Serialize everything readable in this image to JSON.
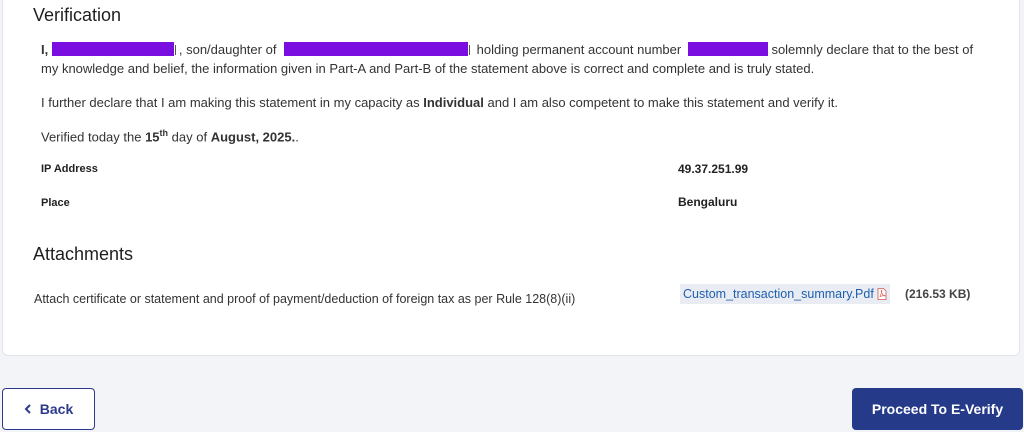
{
  "verification": {
    "title": "Verification",
    "line1": {
      "prefix": "I,",
      "after_name": ", son/daughter of",
      "after_parent": " holding permanent account number",
      "after_pan": " solemnly declare that to the best of",
      "line2": "my knowledge and belief, the information given in Part-A and Part-B of the statement above is correct and complete and is truly stated."
    },
    "capacity": {
      "prefix": "I further declare that I am making this statement in my capacity as ",
      "role": "Individual",
      "suffix": " and I am also competent to make this statement and verify it."
    },
    "verified": {
      "prefix": "Verified today the ",
      "day": "15",
      "day_suffix": "th",
      "middle": " day of ",
      "month_year": "August, 2025.",
      "end": "."
    },
    "ip_label": "IP Address",
    "ip_value": "49.37.251.99",
    "place_label": "Place",
    "place_value": "Bengaluru"
  },
  "attachments": {
    "title": "Attachments",
    "description": "Attach certificate or statement and proof of payment/deduction of foreign tax as per Rule 128(8)(ii)",
    "file_name": "Custom_transaction_summary.Pdf",
    "file_size": "(216.53 KB)",
    "file_icon": "pdf-icon"
  },
  "footer": {
    "back_label": "Back",
    "back_icon": "chevron-left-icon",
    "proceed_label": "Proceed To E-Verify"
  },
  "colors": {
    "primary": "#263a8a",
    "redaction": "#7a0ee0",
    "link": "#1f5fb0"
  }
}
